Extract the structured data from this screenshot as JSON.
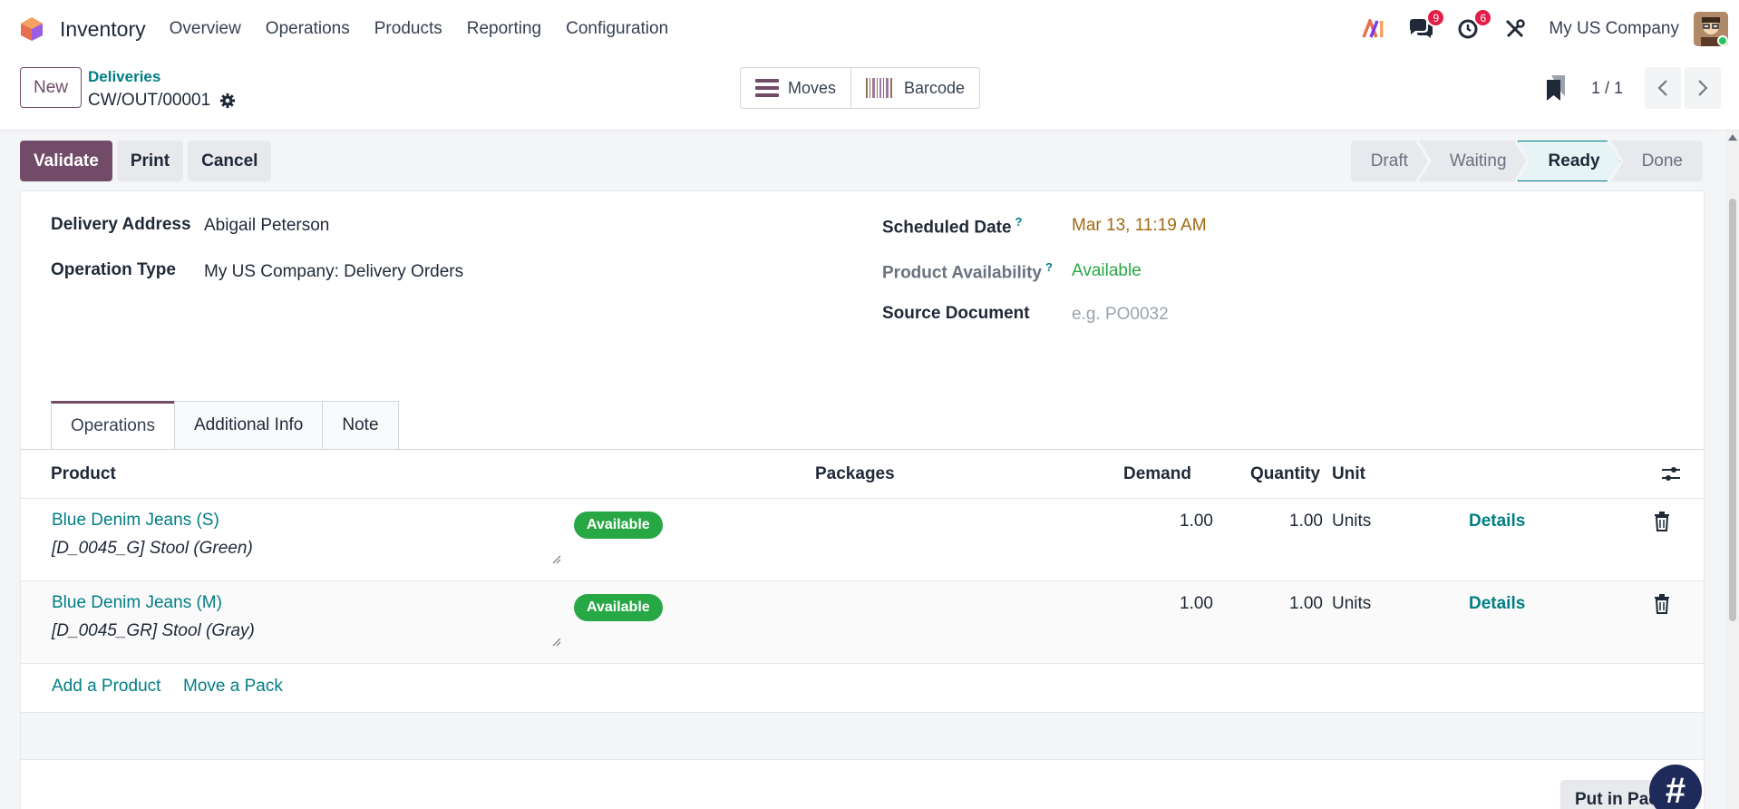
{
  "navbar": {
    "app_name": "Inventory",
    "menu": [
      "Overview",
      "Operations",
      "Products",
      "Reporting",
      "Configuration"
    ],
    "messages_count": "9",
    "activities_count": "6",
    "company": "My US Company"
  },
  "control": {
    "new_label": "New",
    "breadcrumb_parent": "Deliveries",
    "breadcrumb_current": "CW/OUT/00001",
    "smart_buttons": [
      "Moves",
      "Barcode"
    ],
    "pager": "1 / 1"
  },
  "actions": {
    "validate": "Validate",
    "print": "Print",
    "cancel": "Cancel"
  },
  "stages": [
    "Draft",
    "Waiting",
    "Ready",
    "Done"
  ],
  "active_stage": "Ready",
  "form": {
    "delivery_address_label": "Delivery Address",
    "delivery_address": "Abigail Peterson",
    "operation_type_label": "Operation Type",
    "operation_type": "My US Company: Delivery Orders",
    "scheduled_date_label": "Scheduled Date",
    "scheduled_date": "Mar 13, 11:19 AM",
    "availability_label": "Product Availability",
    "availability": "Available",
    "source_document_label": "Source Document",
    "source_document_placeholder": "e.g. PO0032",
    "help_mark": "?"
  },
  "tabs": [
    "Operations",
    "Additional Info",
    "Note"
  ],
  "table": {
    "headers": {
      "product": "Product",
      "packages": "Packages",
      "demand": "Demand",
      "quantity": "Quantity",
      "unit": "Unit"
    },
    "rows": [
      {
        "product": "Blue Denim Jeans (S)",
        "description": "[D_0045_G] Stool (Green)",
        "status": "Available",
        "demand": "1.00",
        "quantity": "1.00",
        "unit": "Units",
        "details": "Details"
      },
      {
        "product": "Blue Denim Jeans (M)",
        "description": "[D_0045_GR] Stool (Gray)",
        "status": "Available",
        "demand": "1.00",
        "quantity": "1.00",
        "unit": "Units",
        "details": "Details"
      }
    ],
    "add_product": "Add a Product",
    "move_pack": "Move a Pack"
  },
  "put_in_pack": "Put in Pack",
  "fab_label": "#",
  "colors": {
    "primary": "#714b67",
    "link": "#017e84",
    "success": "#28a745",
    "badge": "#e11d48"
  }
}
